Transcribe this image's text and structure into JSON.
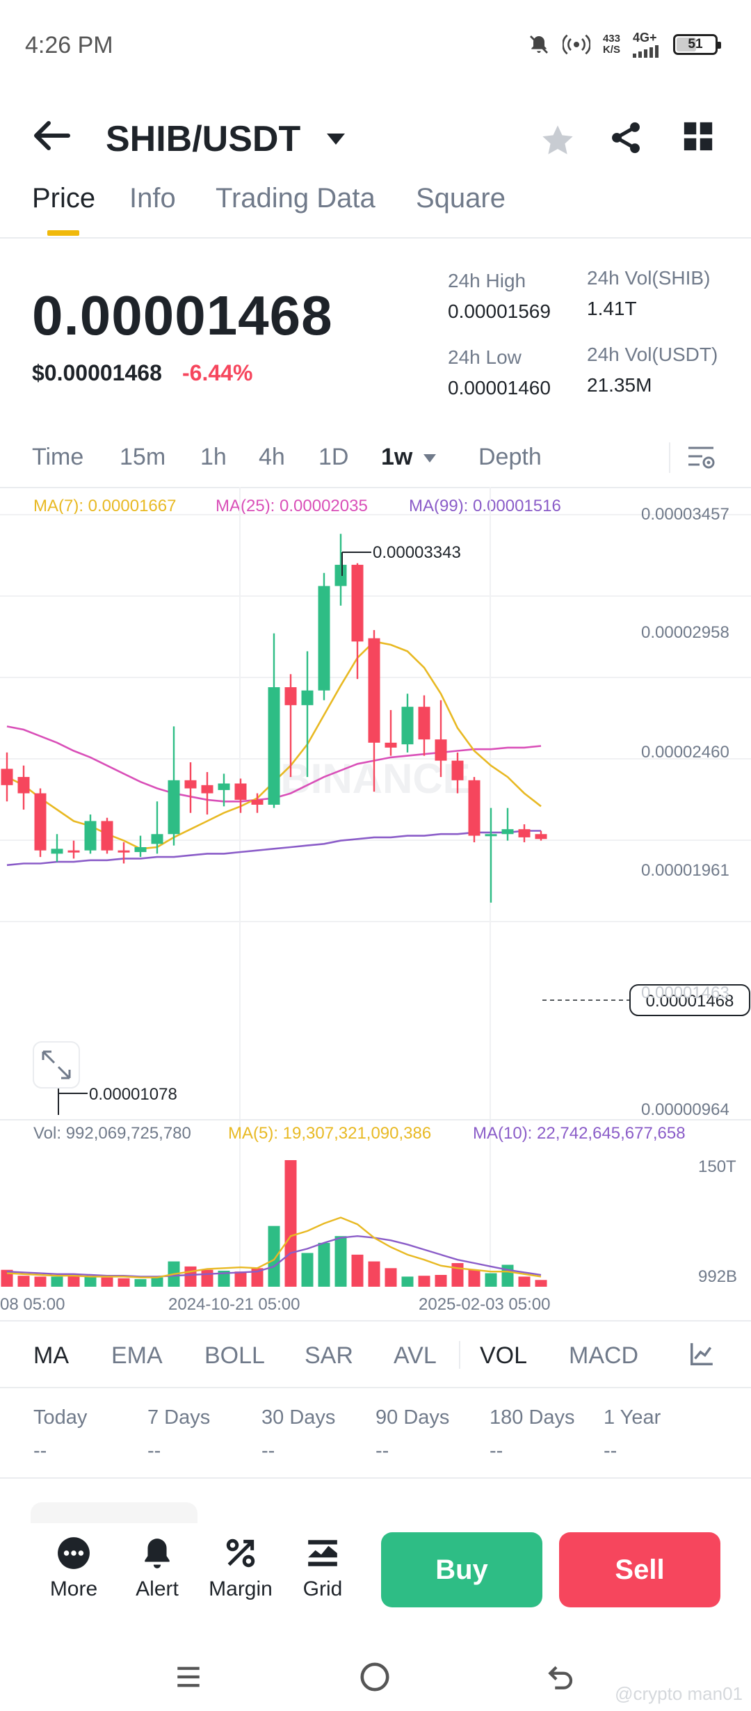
{
  "status_bar": {
    "time": "4:26 PM",
    "net_speed_value": "433",
    "net_speed_unit": "K/S",
    "net_type": "4G+",
    "battery": "51",
    "battery_level": 0.51
  },
  "header": {
    "pair": "SHIB/USDT",
    "icons": [
      "back-arrow-icon",
      "caret-down-icon",
      "star-icon",
      "share-icon",
      "grid-icon"
    ]
  },
  "tabs": [
    "Price",
    "Info",
    "Trading Data",
    "Square"
  ],
  "ticker": {
    "last_price": "0.00001468",
    "usd_price": "$0.00001468",
    "change": "-6.44%",
    "high_label": "24h High",
    "high_value": "0.00001569",
    "low_label": "24h Low",
    "low_value": "0.00001460",
    "vol_base_label": "24h Vol(SHIB)",
    "vol_base_value": "1.41T",
    "vol_quote_label": "24h Vol(USDT)",
    "vol_quote_value": "21.35M"
  },
  "timeframes": [
    "Time",
    "15m",
    "1h",
    "4h",
    "1D",
    "1w",
    "Depth"
  ],
  "ma_legend": {
    "ma7": "MA(7): 0.00001667",
    "ma25": "MA(25): 0.00002035",
    "ma99": "MA(99): 0.00001516"
  },
  "price_axis": [
    "0.00003457",
    "0.00002958",
    "0.00002460",
    "0.00001961",
    "0.00001463",
    "0.00000964"
  ],
  "annotations": {
    "high": "0.00003343",
    "low": "0.00001078",
    "current": "0.00001468"
  },
  "volume_legend": {
    "vol": "Vol: 992,069,725,780",
    "ma5": "MA(5): 19,307,321,090,386",
    "ma10": "MA(10): 22,742,645,677,658"
  },
  "volume_axis": [
    "150T",
    "992B"
  ],
  "date_axis": [
    "08 05:00",
    "2024-10-21 05:00",
    "2025-02-03 05:00"
  ],
  "indicators": [
    "MA",
    "EMA",
    "BOLL",
    "SAR",
    "AVL",
    "VOL",
    "MACD"
  ],
  "performance": {
    "labels": [
      "Today",
      "7 Days",
      "30 Days",
      "90 Days",
      "180 Days",
      "1 Year"
    ],
    "values": [
      "--",
      "--",
      "--",
      "--",
      "--",
      "--"
    ]
  },
  "actions": [
    "More",
    "Alert",
    "Margin",
    "Grid"
  ],
  "buy_label": "Buy",
  "sell_label": "Sell",
  "watermark": "@crypto man01",
  "colors": {
    "up": "#2ebd85",
    "down": "#f6465d",
    "accent": "#f0b90b",
    "ma7": "#e8b923",
    "ma25": "#d94fb8",
    "ma99": "#8a5cc8"
  },
  "chart_data": {
    "type": "candlestick",
    "interval": "1w",
    "y_axis": {
      "min": 9.64e-06,
      "max": 3.457e-05
    },
    "candles": [
      {
        "o": 1.9e-05,
        "c": 1.8e-05,
        "h": 2e-05,
        "l": 1.7e-05
      },
      {
        "o": 1.85e-05,
        "c": 1.75e-05,
        "h": 1.92e-05,
        "l": 1.65e-05
      },
      {
        "o": 1.75e-05,
        "c": 1.4e-05,
        "h": 1.78e-05,
        "l": 1.36e-05
      },
      {
        "o": 1.38e-05,
        "c": 1.41e-05,
        "h": 1.5e-05,
        "l": 1.33e-05
      },
      {
        "o": 1.4e-05,
        "c": 1.39e-05,
        "h": 1.46e-05,
        "l": 1.35e-05
      },
      {
        "o": 1.4e-05,
        "c": 1.58e-05,
        "h": 1.62e-05,
        "l": 1.38e-05
      },
      {
        "o": 1.58e-05,
        "c": 1.4e-05,
        "h": 1.6e-05,
        "l": 1.38e-05
      },
      {
        "o": 1.4e-05,
        "c": 1.39e-05,
        "h": 1.45e-05,
        "l": 1.32e-05
      },
      {
        "o": 1.39e-05,
        "c": 1.42e-05,
        "h": 1.49e-05,
        "l": 1.36e-05
      },
      {
        "o": 1.44e-05,
        "c": 1.5e-05,
        "h": 1.7e-05,
        "l": 1.38e-05
      },
      {
        "o": 1.5e-05,
        "c": 1.83e-05,
        "h": 2.16e-05,
        "l": 1.43e-05
      },
      {
        "o": 1.83e-05,
        "c": 1.78e-05,
        "h": 1.94e-05,
        "l": 1.63e-05
      },
      {
        "o": 1.8e-05,
        "c": 1.75e-05,
        "h": 1.88e-05,
        "l": 1.62e-05
      },
      {
        "o": 1.77e-05,
        "c": 1.81e-05,
        "h": 1.87e-05,
        "l": 1.67e-05
      },
      {
        "o": 1.81e-05,
        "c": 1.71e-05,
        "h": 1.84e-05,
        "l": 1.63e-05
      },
      {
        "o": 1.71e-05,
        "c": 1.68e-05,
        "h": 1.75e-05,
        "l": 1.63e-05
      },
      {
        "o": 1.68e-05,
        "c": 2.4e-05,
        "h": 2.73e-05,
        "l": 1.66e-05
      },
      {
        "o": 2.4e-05,
        "c": 2.29e-05,
        "h": 2.48e-05,
        "l": 1.85e-05
      },
      {
        "o": 2.29e-05,
        "c": 2.38e-05,
        "h": 2.62e-05,
        "l": 1.85e-05
      },
      {
        "o": 2.38e-05,
        "c": 3.02e-05,
        "h": 3.1e-05,
        "l": 2.32e-05
      },
      {
        "o": 3.02e-05,
        "c": 3.15e-05,
        "h": 3.34e-05,
        "l": 2.9e-05
      },
      {
        "o": 3.15e-05,
        "c": 2.68e-05,
        "h": 3.16e-05,
        "l": 2.45e-05
      },
      {
        "o": 2.7e-05,
        "c": 2.06e-05,
        "h": 2.75e-05,
        "l": 1.76e-05
      },
      {
        "o": 2.06e-05,
        "c": 2.03e-05,
        "h": 2.26e-05,
        "l": 1.98e-05
      },
      {
        "o": 2.05e-05,
        "c": 2.28e-05,
        "h": 2.36e-05,
        "l": 2e-05
      },
      {
        "o": 2.28e-05,
        "c": 2.08e-05,
        "h": 2.35e-05,
        "l": 1.98e-05
      },
      {
        "o": 2.08e-05,
        "c": 1.95e-05,
        "h": 2.32e-05,
        "l": 1.85e-05
      },
      {
        "o": 1.95e-05,
        "c": 1.83e-05,
        "h": 2e-05,
        "l": 1.75e-05
      },
      {
        "o": 1.83e-05,
        "c": 1.49e-05,
        "h": 1.85e-05,
        "l": 1.45e-05
      },
      {
        "o": 1.5e-05,
        "c": 1.5e-05,
        "h": 1.66e-05,
        "l": 1.08e-05
      },
      {
        "o": 1.5e-05,
        "c": 1.53e-05,
        "h": 1.66e-05,
        "l": 1.46e-05
      },
      {
        "o": 1.53e-05,
        "c": 1.48e-05,
        "h": 1.56e-05,
        "l": 1.45e-05
      },
      {
        "o": 1.5e-05,
        "c": 1.47e-05,
        "h": 1.52e-05,
        "l": 1.46e-05
      }
    ],
    "ma7": [
      1.85e-05,
      1.8e-05,
      1.72e-05,
      1.65e-05,
      1.58e-05,
      1.55e-05,
      1.5e-05,
      1.46e-05,
      1.41e-05,
      1.42e-05,
      1.48e-05,
      1.53e-05,
      1.58e-05,
      1.63e-05,
      1.67e-05,
      1.72e-05,
      1.82e-05,
      1.92e-05,
      2.05e-05,
      2.23e-05,
      2.41e-05,
      2.58e-05,
      2.68e-05,
      2.66e-05,
      2.62e-05,
      2.52e-05,
      2.36e-05,
      2.15e-05,
      2.01e-05,
      1.92e-05,
      1.85e-05,
      1.75e-05,
      1.67e-05
    ],
    "ma25": [
      2.16e-05,
      2.14e-05,
      2.1e-05,
      2.06e-05,
      2.01e-05,
      1.97e-05,
      1.92e-05,
      1.87e-05,
      1.82e-05,
      1.78e-05,
      1.75e-05,
      1.73e-05,
      1.71e-05,
      1.7e-05,
      1.7e-05,
      1.71e-05,
      1.72e-05,
      1.75e-05,
      1.8e-05,
      1.85e-05,
      1.89e-05,
      1.93e-05,
      1.95e-05,
      1.97e-05,
      1.98e-05,
      1.99e-05,
      2e-05,
      2.01e-05,
      2.02e-05,
      2.02e-05,
      2.03e-05,
      2.03e-05,
      2.04e-05
    ],
    "ma99": [
      1.31e-05,
      1.32e-05,
      1.32e-05,
      1.33e-05,
      1.33e-05,
      1.34e-05,
      1.34e-05,
      1.35e-05,
      1.35e-05,
      1.36e-05,
      1.36e-05,
      1.37e-05,
      1.38e-05,
      1.38e-05,
      1.39e-05,
      1.4e-05,
      1.41e-05,
      1.42e-05,
      1.43e-05,
      1.44e-05,
      1.46e-05,
      1.47e-05,
      1.48e-05,
      1.48e-05,
      1.49e-05,
      1.49e-05,
      1.5e-05,
      1.5e-05,
      1.51e-05,
      1.51e-05,
      1.51e-05,
      1.52e-05,
      1.52e-05
    ],
    "volume": {
      "max": 150,
      "unit": "T",
      "values": [
        20,
        13,
        12,
        12,
        14,
        12,
        11,
        10,
        9,
        11,
        30,
        24,
        20,
        19,
        18,
        22,
        72,
        150,
        40,
        52,
        60,
        38,
        30,
        22,
        12,
        13,
        14,
        28,
        20,
        16,
        26,
        12,
        8
      ],
      "ma5": [
        16,
        15,
        14,
        13,
        13,
        12,
        12,
        12,
        11,
        11,
        15,
        18,
        21,
        22,
        23,
        22,
        32,
        60,
        66,
        75,
        82,
        74,
        58,
        47,
        38,
        32,
        25,
        22,
        20,
        18,
        18,
        15,
        12
      ],
      "ma10": [
        18,
        17,
        16,
        15,
        15,
        14,
        13,
        13,
        12,
        12,
        13,
        14,
        15,
        16,
        17,
        18,
        24,
        40,
        45,
        52,
        58,
        60,
        58,
        55,
        50,
        44,
        38,
        32,
        28,
        24,
        20,
        17,
        14
      ]
    }
  }
}
